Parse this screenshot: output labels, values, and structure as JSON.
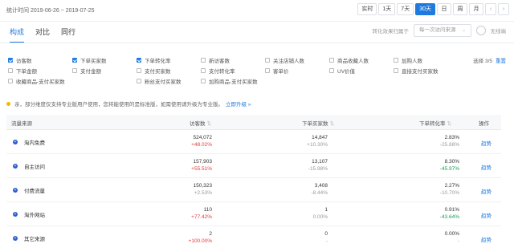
{
  "topbar": {
    "range_label": "统计时间 2019-06-26 ~ 2019-07-25",
    "buttons": [
      "实时",
      "1天",
      "7天",
      "30天",
      "日",
      "周",
      "月"
    ],
    "active_button": "30天",
    "prev_icon": "chevron-left-icon",
    "next_icon": "chevron-right-icon"
  },
  "tabs": [
    {
      "label": "构成",
      "active": true
    },
    {
      "label": "对比",
      "active": false
    },
    {
      "label": "同行",
      "active": false
    }
  ],
  "filter": {
    "prefix": "转化效果归属于",
    "select_value": "每一次访问来源",
    "toggle_label": "无线端"
  },
  "metrics": {
    "rows": [
      [
        {
          "label": "访客数",
          "checked": true
        },
        {
          "label": "下单买家数",
          "checked": true
        },
        {
          "label": "下单转化率",
          "checked": true
        },
        {
          "label": "新访客数",
          "checked": false
        },
        {
          "label": "关注店铺人数",
          "checked": false
        },
        {
          "label": "商品收藏人数",
          "checked": false
        },
        {
          "label": "加购人数",
          "checked": false
        }
      ],
      [
        {
          "label": "下单金额",
          "checked": false
        },
        {
          "label": "支付金额",
          "checked": false
        },
        {
          "label": "支付买家数",
          "checked": false
        },
        {
          "label": "支付转化率",
          "checked": false
        },
        {
          "label": "客单价",
          "checked": false
        },
        {
          "label": "UV价值",
          "checked": false
        },
        {
          "label": "直接支付买家数",
          "checked": false
        }
      ],
      [
        {
          "label": "收藏商品-支付买家数",
          "checked": false
        },
        {
          "label": "粉丝支付买家数",
          "checked": false
        },
        {
          "label": "加购商品-支付买家数",
          "checked": false
        }
      ]
    ],
    "selected_count": "选择 3/5",
    "restore_label": "重置"
  },
  "notice": {
    "text": "亲，部分维度仅支持专业版用户使用，您将能使用的是标准版，如需使用请升级为专业版。",
    "link": "立即升级 »"
  },
  "table": {
    "headers": {
      "source": "流量来源",
      "visitors": "访客数",
      "buyers": "下单买家数",
      "conversion": "下单转化率",
      "action": "操作"
    },
    "rows": [
      {
        "name": "淘内免费",
        "visitors": "524,072",
        "visitors_chg": "+48.02%",
        "visitors_dir": "up",
        "buyers": "14,847",
        "buyers_chg": "+10.30%",
        "buyers_dir": "down",
        "conv": "2.83%",
        "conv_chg": "-25.88%",
        "conv_dir": "down",
        "action": "趋势"
      },
      {
        "name": "自主访问",
        "visitors": "157,903",
        "visitors_chg": "+55.51%",
        "visitors_dir": "up",
        "buyers": "13,107",
        "buyers_chg": "-15.98%",
        "buyers_dir": "down",
        "conv": "8.30%",
        "conv_chg": "-45.97%",
        "conv_dir": "green",
        "action": "趋势"
      },
      {
        "name": "付费流量",
        "visitors": "150,323",
        "visitors_chg": "+2.53%",
        "visitors_dir": "down",
        "buyers": "3,408",
        "buyers_chg": "-8.44%",
        "buyers_dir": "down",
        "conv": "2.27%",
        "conv_chg": "-10.70%",
        "conv_dir": "down",
        "action": "趋势"
      },
      {
        "name": "淘外网站",
        "visitors": "110",
        "visitors_chg": "+77.42%",
        "visitors_dir": "up",
        "buyers": "1",
        "buyers_chg": "0.00%",
        "buyers_dir": "down",
        "conv": "0.91%",
        "conv_chg": "-43.64%",
        "conv_dir": "green",
        "action": "趋势"
      },
      {
        "name": "其它来源",
        "visitors": "2",
        "visitors_chg": "+100.00%",
        "visitors_dir": "up",
        "buyers": "0",
        "buyers_chg": "-",
        "buyers_dir": "down",
        "conv": "0.00%",
        "conv_chg": "-",
        "conv_dir": "down",
        "action": "趋势"
      }
    ]
  }
}
